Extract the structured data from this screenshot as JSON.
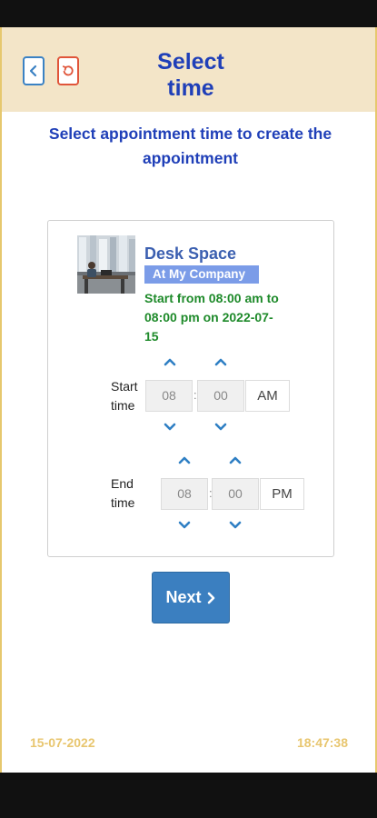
{
  "header": {
    "title_line1": "Select",
    "title_line2": "time"
  },
  "instruction_line1": "Select appointment time to create the",
  "instruction_line2": "appointment",
  "service": {
    "name": "Desk Space",
    "badge": "At My Company",
    "range_line1": "Start from 08:00 am to",
    "range_line2": "08:00 pm on 2022-07-",
    "range_line3": "15"
  },
  "start_time": {
    "label_line1": "Start",
    "label_line2": "time",
    "hour": "08",
    "minute": "00",
    "period": "AM"
  },
  "end_time": {
    "label_line1": "End",
    "label_line2": "time",
    "hour": "08",
    "minute": "00",
    "period": "PM"
  },
  "next_label": "Next",
  "footer": {
    "date": "15-07-2022",
    "time": "18:47:38"
  },
  "colors": {
    "accent": "#3b7fc0",
    "title": "#1f3fb8",
    "header_bg": "#f3e5c8",
    "green": "#1e8a2a",
    "footer": "#e8c66f"
  }
}
